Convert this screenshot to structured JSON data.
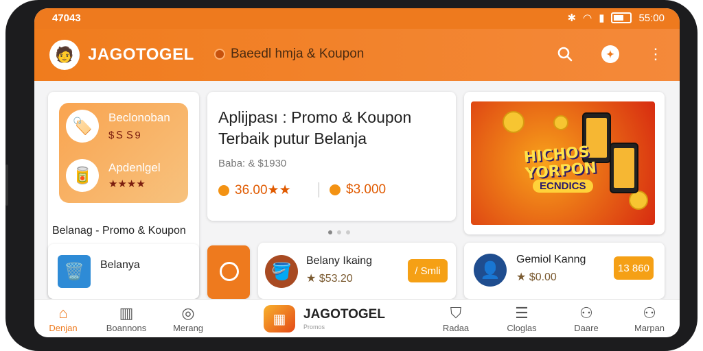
{
  "status_bar": {
    "time_left": "47043",
    "time_right": "55:00"
  },
  "app_bar": {
    "brand": "JAGOTOGEL",
    "subtitle": "Baeedl hmja & Koupon"
  },
  "icons": {
    "search": "search-icon",
    "account": "account-icon",
    "menu": "more-vert-icon"
  },
  "promo_card": {
    "items": [
      {
        "name": "Beclonoban",
        "price": "$ＳＳ9",
        "icon": "🏷️"
      },
      {
        "name": "Apdenlgel",
        "price": "★★★★",
        "icon": "🥫"
      }
    ],
    "title": "Belanag - Promo & Koupon"
  },
  "hero": {
    "title": "Aplijpası : Promo & Koupon Terbaik putur Belanja",
    "label": "Baba: & $1930",
    "price_1": "36.00★★",
    "price_2": "$3.000"
  },
  "banner": {
    "line1": "HICHOS",
    "line2": "YORPON",
    "line3": "ECNDICS"
  },
  "row_left": {
    "name": "Belanya"
  },
  "row_mid": {
    "name": "Belany Ikaing",
    "price": "★ $53.20",
    "button": "/ Smli"
  },
  "row_right": {
    "name": "Gemiol Kanng",
    "price": "★ $0.00",
    "button": "13 860"
  },
  "bottom_nav": {
    "items": [
      {
        "label": "Denjan",
        "active": true
      },
      {
        "label": "Boannons"
      },
      {
        "label": "Merang"
      },
      {
        "label": "Radaa"
      },
      {
        "label": "Cloglas"
      },
      {
        "label": "Daare"
      },
      {
        "label": "Marpan"
      }
    ],
    "brand": "JAGOTOGEL",
    "brand_sub": "Promos"
  },
  "colors": {
    "accent": "#ee7a1e",
    "button": "#f5a015"
  }
}
